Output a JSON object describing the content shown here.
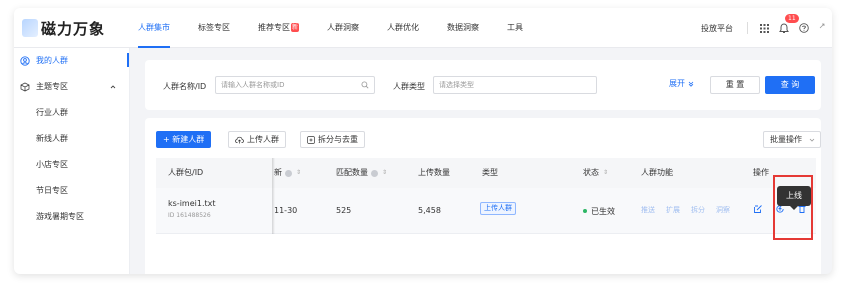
{
  "brand": {
    "name": "磁力万象"
  },
  "nav": [
    {
      "label": "人群集市",
      "active": true,
      "tag": ""
    },
    {
      "label": "标签专区",
      "active": false,
      "tag": ""
    },
    {
      "label": "推荐专区",
      "active": false,
      "tag": "新"
    },
    {
      "label": "人群洞察",
      "active": false,
      "tag": ""
    },
    {
      "label": "人群优化",
      "active": false,
      "tag": ""
    },
    {
      "label": "数据洞察",
      "active": false,
      "tag": ""
    },
    {
      "label": "工具",
      "active": false,
      "tag": ""
    }
  ],
  "header_right": {
    "platform_link": "投放平台",
    "notification_count": "11"
  },
  "sidebar": {
    "my_audience": "我的人群",
    "topic_zone": "主题专区",
    "items": [
      "行业人群",
      "新线人群",
      "小店专区",
      "节日专区",
      "游戏暑期专区"
    ]
  },
  "filter": {
    "name_label": "人群名称/ID",
    "name_placeholder": "请输入人群名称或ID",
    "type_label": "人群类型",
    "type_placeholder": "请选择类型",
    "expand_label": "展开",
    "reset_label": "重 置",
    "query_label": "查 询"
  },
  "toolbar": {
    "new_audience": "+ 新建人群",
    "upload_audience": "上传人群",
    "split_dedupe": "拆分与去重",
    "batch_ops": "批量操作"
  },
  "table": {
    "columns": {
      "name_id": "人群包/ID",
      "updated": "新",
      "match_count": "匹配数量",
      "upload_count": "上传数量",
      "type": "类型",
      "status": "状态",
      "functions": "人群功能",
      "actions": "操作"
    },
    "rows": [
      {
        "name": "ks-imei1.txt",
        "id": "ID 161488526",
        "updated": "11-30",
        "match_count": "525",
        "upload_count": "5,458",
        "type": "上传人群",
        "status": "已生效",
        "functions": [
          "推送",
          "扩展",
          "拆分",
          "洞察"
        ]
      }
    ]
  },
  "tooltip": {
    "text": "上线"
  },
  "colors": {
    "primary": "#1f6ff5",
    "highlight": "#e53935",
    "status_active": "#2db665"
  }
}
